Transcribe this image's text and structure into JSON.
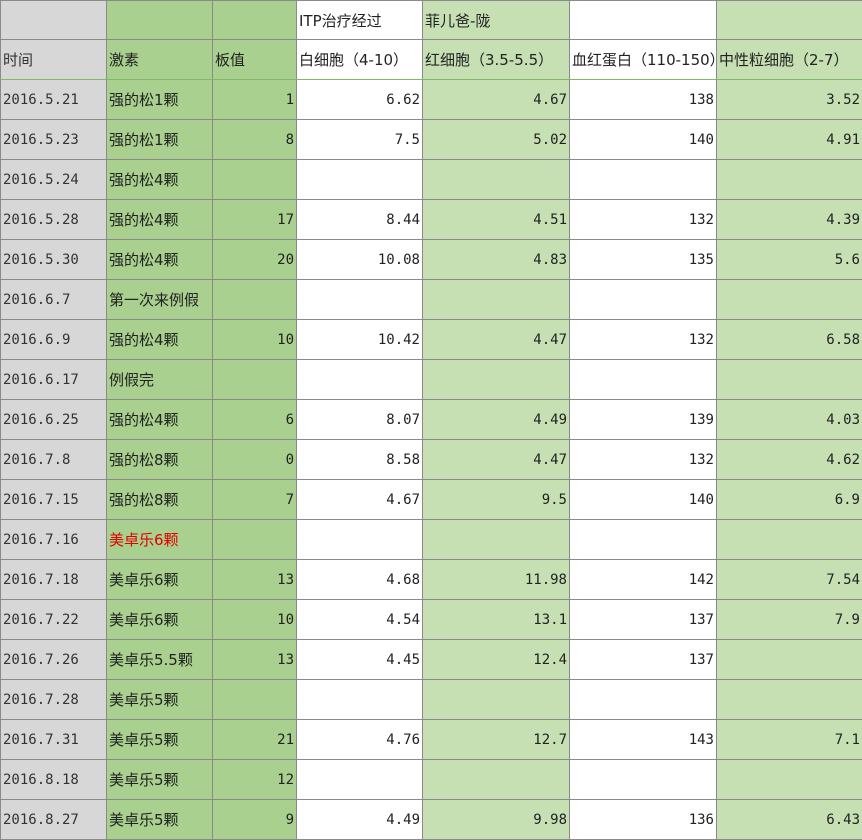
{
  "title": {
    "left": "ITP治疗经过",
    "right": "菲儿爸-陇"
  },
  "headers": [
    "时间",
    "激素",
    "板值",
    "白细胞（4-10）",
    "红细胞（3.5-5.5）",
    "血红蛋白（110-150）",
    "中性粒细胞（2-7）"
  ],
  "highlight_color": "#e00000",
  "rows": [
    {
      "date": "2016.5.21",
      "hormone": "强的松1颗",
      "platelet": "1",
      "wbc": "6.62",
      "rbc": "4.67",
      "hgb": "138",
      "neut": "3.52"
    },
    {
      "date": "2016.5.23",
      "hormone": "强的松1颗",
      "platelet": "8",
      "wbc": "7.5",
      "rbc": "5.02",
      "hgb": "140",
      "neut": "4.91"
    },
    {
      "date": "2016.5.24",
      "hormone": "强的松4颗",
      "platelet": "",
      "wbc": "",
      "rbc": "",
      "hgb": "",
      "neut": ""
    },
    {
      "date": "2016.5.28",
      "hormone": "强的松4颗",
      "platelet": "17",
      "wbc": "8.44",
      "rbc": "4.51",
      "hgb": "132",
      "neut": "4.39"
    },
    {
      "date": "2016.5.30",
      "hormone": "强的松4颗",
      "platelet": "20",
      "wbc": "10.08",
      "rbc": "4.83",
      "hgb": "135",
      "neut": "5.6"
    },
    {
      "date": "2016.6.7",
      "hormone": "第一次来例假",
      "platelet": "",
      "wbc": "",
      "rbc": "",
      "hgb": "",
      "neut": ""
    },
    {
      "date": "2016.6.9",
      "hormone": "强的松4颗",
      "platelet": "10",
      "wbc": "10.42",
      "rbc": "4.47",
      "hgb": "132",
      "neut": "6.58"
    },
    {
      "date": "2016.6.17",
      "hormone": "例假完",
      "platelet": "",
      "wbc": "",
      "rbc": "",
      "hgb": "",
      "neut": ""
    },
    {
      "date": "2016.6.25",
      "hormone": "强的松4颗",
      "platelet": "6",
      "wbc": "8.07",
      "rbc": "4.49",
      "hgb": "139",
      "neut": "4.03"
    },
    {
      "date": "2016.7.8",
      "hormone": "强的松8颗",
      "platelet": "0",
      "wbc": "8.58",
      "rbc": "4.47",
      "hgb": "132",
      "neut": "4.62"
    },
    {
      "date": "2016.7.15",
      "hormone": "强的松8颗",
      "platelet": "7",
      "wbc": "4.67",
      "rbc": "9.5",
      "hgb": "140",
      "neut": "6.9"
    },
    {
      "date": "2016.7.16",
      "hormone": "美卓乐6颗",
      "platelet": "",
      "wbc": "",
      "rbc": "",
      "hgb": "",
      "neut": "",
      "highlight": true
    },
    {
      "date": "2016.7.18",
      "hormone": "美卓乐6颗",
      "platelet": "13",
      "wbc": "4.68",
      "rbc": "11.98",
      "hgb": "142",
      "neut": "7.54"
    },
    {
      "date": "2016.7.22",
      "hormone": "美卓乐6颗",
      "platelet": "10",
      "wbc": "4.54",
      "rbc": "13.1",
      "hgb": "137",
      "neut": "7.9"
    },
    {
      "date": "2016.7.26",
      "hormone": "美卓乐5.5颗",
      "platelet": "13",
      "wbc": "4.45",
      "rbc": "12.4",
      "hgb": "137",
      "neut": ""
    },
    {
      "date": "2016.7.28",
      "hormone": "美卓乐5颗",
      "platelet": "",
      "wbc": "",
      "rbc": "",
      "hgb": "",
      "neut": ""
    },
    {
      "date": "2016.7.31",
      "hormone": "美卓乐5颗",
      "platelet": "21",
      "wbc": "4.76",
      "rbc": "12.7",
      "hgb": "143",
      "neut": "7.1"
    },
    {
      "date": "2016.8.18",
      "hormone": "美卓乐5颗",
      "platelet": "12",
      "wbc": "",
      "rbc": "",
      "hgb": "",
      "neut": ""
    },
    {
      "date": "2016.8.27",
      "hormone": "美卓乐5颗",
      "platelet": "9",
      "wbc": "4.49",
      "rbc": "9.98",
      "hgb": "136",
      "neut": "6.43"
    }
  ]
}
